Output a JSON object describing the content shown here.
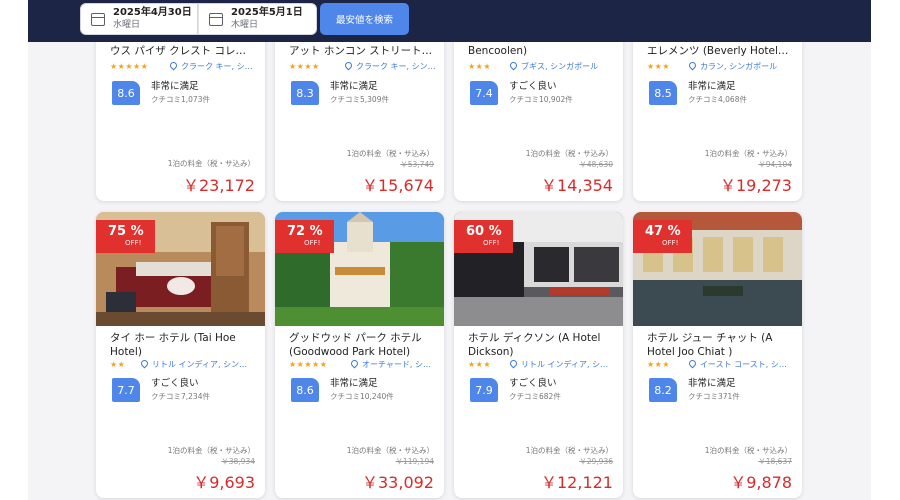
{
  "header": {
    "checkin": {
      "date": "2025年4月30日",
      "day": "水曜日"
    },
    "checkout": {
      "date": "2025年5月1日",
      "day": "木曜日"
    },
    "search_label": "最安値を検索"
  },
  "common": {
    "price_label": "1泊の料金（税・サ込み）",
    "off_label": "OFF!"
  },
  "hotels": [
    {
      "name": "ウス パイザ クレスト コレ…",
      "stars": "★★★★★",
      "location": "クラーク キー, シ…",
      "score": "8.6",
      "rating": "非常に満足",
      "reviews": "クチコミ1,073件",
      "original_price": "",
      "price": "￥23,172"
    },
    {
      "name": "アット ホンコン ストリート…",
      "stars": "★★★★",
      "location": "クラーク キー, シン…",
      "score": "8.3",
      "rating": "非常に満足",
      "reviews": "クチコミ5,309件",
      "original_price": "￥53,749",
      "price": "￥15,674"
    },
    {
      "name": "Bencoolen)",
      "stars": "★★★",
      "location": "ブギス, シンガポール",
      "score": "7.4",
      "rating": "すごく良い",
      "reviews": "クチコミ10,902件",
      "original_price": "￥48,630",
      "price": "￥14,354"
    },
    {
      "name": "エレメンツ (Beverly Hotels…",
      "stars": "★★★",
      "location": "カラン, シンガポール",
      "score": "8.5",
      "rating": "非常に満足",
      "reviews": "クチコミ4,068件",
      "original_price": "￥94,104",
      "price": "￥19,273"
    },
    {
      "discount": "75 %",
      "name": "タイ ホー ホテル (Tai Hoe Hotel)",
      "stars": "★★",
      "location": "リトル インディア, シン…",
      "score": "7.7",
      "rating": "すごく良い",
      "reviews": "クチコミ7,234件",
      "original_price": "￥38,934",
      "price": "￥9,693"
    },
    {
      "discount": "72 %",
      "name": "グッドウッド パーク ホテル (Goodwood Park Hotel)",
      "stars": "★★★★★",
      "location": "オーチャード, シ…",
      "score": "8.6",
      "rating": "非常に満足",
      "reviews": "クチコミ10,240件",
      "original_price": "￥119,194",
      "price": "￥33,092"
    },
    {
      "discount": "60 %",
      "name": "ホテル ディクソン (A Hotel Dickson)",
      "stars": "★★★",
      "location": "リトル インディア, シ…",
      "score": "7.9",
      "rating": "すごく良い",
      "reviews": "クチコミ682件",
      "original_price": "￥29,936",
      "price": "￥12,121"
    },
    {
      "discount": "47 %",
      "name": "ホテル ジュー チャット (A Hotel Joo Chiat )",
      "stars": "★★★",
      "location": "イースト コースト, シ…",
      "score": "8.2",
      "rating": "非常に満足",
      "reviews": "クチコミ371件",
      "original_price": "￥18,637",
      "price": "￥9,878"
    }
  ],
  "colors": {
    "header_bg": "#1d2547",
    "accent": "#4e86ea",
    "price": "#d92b2b",
    "badge": "#e1312e",
    "stars": "#f3a21b"
  }
}
